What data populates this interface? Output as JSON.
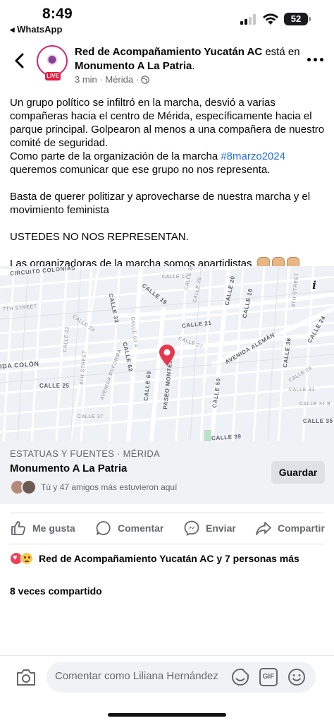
{
  "status_bar": {
    "time": "8:49",
    "back_app": "◂ WhatsApp",
    "battery": "52"
  },
  "header": {
    "page_name": "Red de Acompañamiento Yucatán AC",
    "connector": " está en ",
    "location": "Monumento A La Patria",
    "period": ".",
    "meta": "3 min · Mérida ·",
    "live_badge": "LIVE"
  },
  "post": {
    "p1": "Un grupo político se infiltró en la marcha, desvió a varias compañeras hacia el centro de Mérida, específicamente hacia el parque principal. Golpearon al menos a una compañera de nuestro comité de seguridad.",
    "p2_before": "Como parte de la organización de la marcha ",
    "p2_hashtag": "#8marzo2024",
    "p2_after": " queremos comunicar que ese grupo no nos representa.",
    "p3": "Basta de querer politizar y aprovecharse de nuestra marcha y el movimiento feminista",
    "p4": "USTEDES NO NOS REPRESENTAN.",
    "p5": "Las organizadoras de la marcha somos apartidistas"
  },
  "map": {
    "labels": {
      "circuito_colonias": "CIRCUITO COLONIAS",
      "calle_19": "CALLE 19",
      "calle_20": "CALLE 20",
      "calle_18": "CALLE 18",
      "calle_21": "CALLE 21",
      "calle_33": "CALLE 33",
      "calle_62": "CALLE 62",
      "calle_60": "CALLE 60",
      "calle_50": "CALLE 50",
      "calle_36": "CALLE 36",
      "calle_24": "CALLE 24",
      "calle_25": "CALLE 25",
      "calle_35": "CALLE 35",
      "calle_39": "CALLE 39",
      "avenida_aleman": "AVENIDA ALEMÁN",
      "paseo_montejo": "PASEO MONTEJO",
      "avenida_colon": "IDA COLÓN",
      "eighth_street": "8TH STREET",
      "seventh_street": "7TH STREET",
      "calle_27": "CALLE 27",
      "calle_28": "CALLE 28",
      "calle_13": "CALLE 13",
      "calle_26": "CALLE 26",
      "calle_31": "CALLE 31",
      "calle_31b": "CALLE 31 B",
      "calle_22": "CALLE 22",
      "calle_37": "CALLE 37",
      "calle_60a": "CALLE 60 A",
      "calle_23": "CALLE 23",
      "calle_29": "CALLE 29",
      "avenida_reforma": "AVENIDA REFORMA"
    }
  },
  "place": {
    "category": "ESTATUAS Y FUENTES · MÉRIDA",
    "name": "Monumento A La Patria",
    "save_label": "Guardar",
    "friends_text": "Tú y 47 amigos más estuvieron aquí"
  },
  "actions": {
    "like": "Me gusta",
    "comment": "Comentar",
    "send": "Enviar",
    "share": "Compartir"
  },
  "reactions_text": "Red de Acompañamiento Yucatán AC y 7 personas más",
  "shares_text": "8 veces compartido",
  "comment_bar": {
    "placeholder": "Comentar como Liliana Hernández",
    "gif": "GIF"
  },
  "colors": {
    "accent": "#216fdb",
    "heart": "#f33e58",
    "pin": "#e8364e"
  }
}
